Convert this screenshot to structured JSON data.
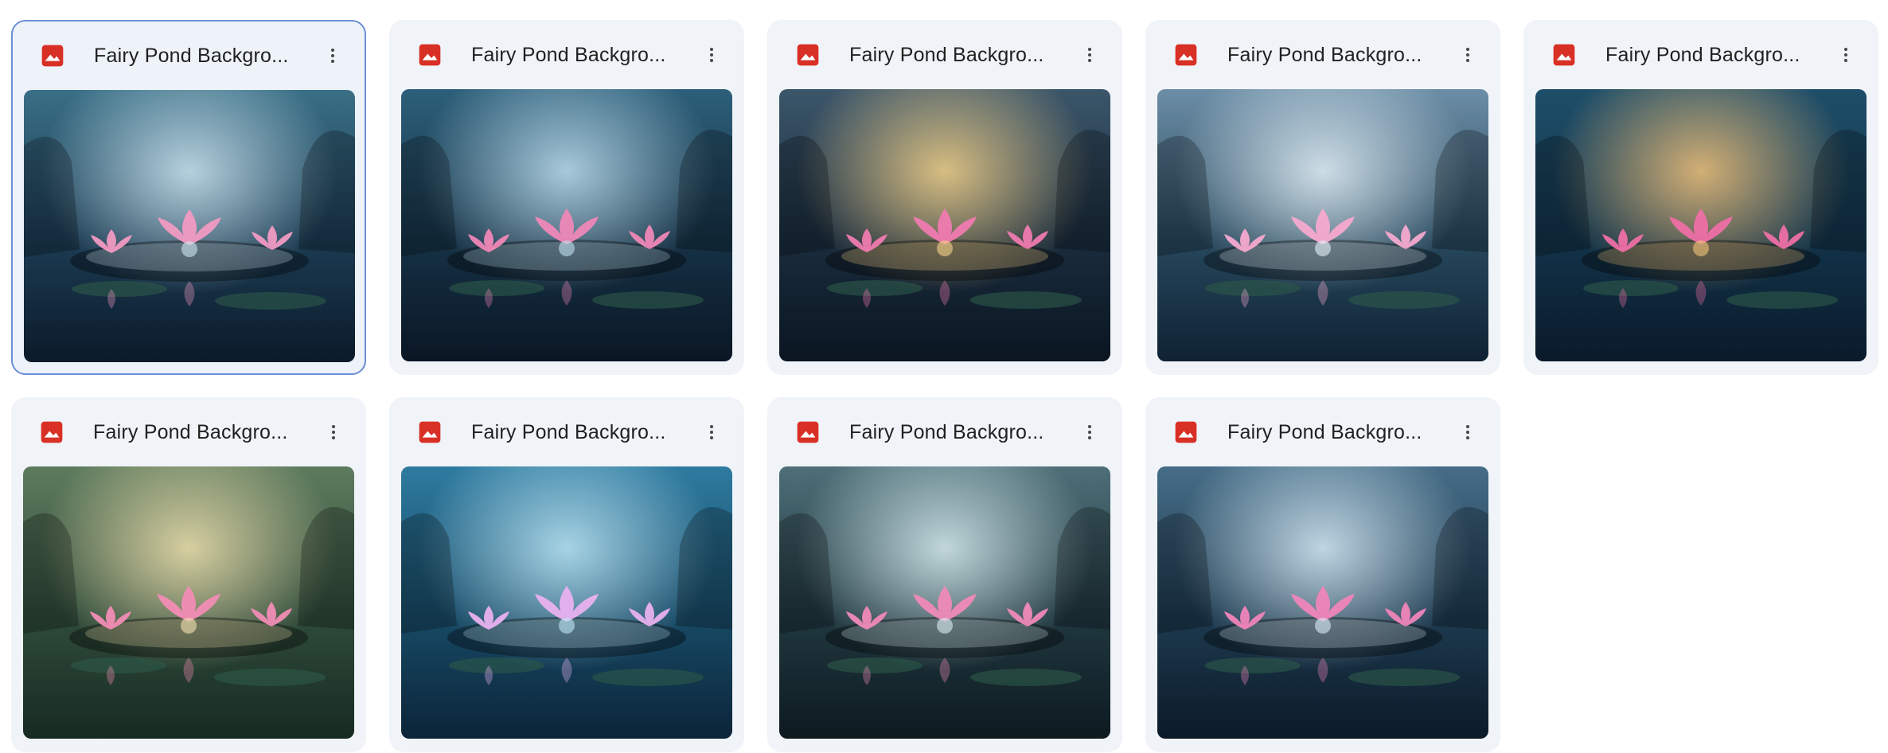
{
  "files": [
    {
      "title": "Fairy Pond Backgro...",
      "selected": true,
      "icon": "image-file-icon",
      "palette": {
        "top": "#3a6f86",
        "mid": "#1b3b52",
        "bottom": "#0c1a2a",
        "glow": "#cfe7f2",
        "lotus": "#f19ac2"
      }
    },
    {
      "title": "Fairy Pond Backgro...",
      "selected": false,
      "icon": "image-file-icon",
      "palette": {
        "top": "#2d5f7a",
        "mid": "#163246",
        "bottom": "#0a1624",
        "glow": "#bfe0f0",
        "lotus": "#ef88b8"
      }
    },
    {
      "title": "Fairy Pond Backgro...",
      "selected": false,
      "icon": "image-file-icon",
      "palette": {
        "top": "#3b566a",
        "mid": "#1a2c3d",
        "bottom": "#0a1521",
        "glow": "#f6d48a",
        "lotus": "#f07bb0"
      }
    },
    {
      "title": "Fairy Pond Backgro...",
      "selected": false,
      "icon": "image-file-icon",
      "palette": {
        "top": "#6c8ea6",
        "mid": "#27485d",
        "bottom": "#0f2233",
        "glow": "#e5f1f8",
        "lotus": "#f6a9cf"
      }
    },
    {
      "title": "Fairy Pond Backgro...",
      "selected": false,
      "icon": "image-file-icon",
      "palette": {
        "top": "#1e4e69",
        "mid": "#123349",
        "bottom": "#0a1a2a",
        "glow": "#f4c37a",
        "lotus": "#ee6fa6"
      }
    },
    {
      "title": "Fairy Pond Backgro...",
      "selected": false,
      "icon": "image-file-icon",
      "palette": {
        "top": "#5e7b5e",
        "mid": "#2f4b3a",
        "bottom": "#172a22",
        "glow": "#f1e2b0",
        "lotus": "#f28db5"
      }
    },
    {
      "title": "Fairy Pond Backgro...",
      "selected": false,
      "icon": "image-file-icon",
      "palette": {
        "top": "#2e7ba0",
        "mid": "#184a66",
        "bottom": "#0b2438",
        "glow": "#bfe8f7",
        "lotus": "#e9b2f0"
      }
    },
    {
      "title": "Fairy Pond Backgro...",
      "selected": false,
      "icon": "image-file-icon",
      "palette": {
        "top": "#4e6f78",
        "mid": "#20373f",
        "bottom": "#0d1a20",
        "glow": "#d9eef2",
        "lotus": "#f08ab8"
      }
    },
    {
      "title": "Fairy Pond Backgro...",
      "selected": false,
      "icon": "image-file-icon",
      "palette": {
        "top": "#466d87",
        "mid": "#1d3a4f",
        "bottom": "#0c1a28",
        "glow": "#d8ecf7",
        "lotus": "#f085ba"
      }
    }
  ],
  "icons": {
    "file_type": "image-file-icon",
    "more": "more-vertical-icon"
  },
  "colors": {
    "file_icon_red": "#d93025",
    "selected_border": "#6a8fd6",
    "card_bg": "#f0f4f9",
    "title_text": "#1f1f1f",
    "more_icon": "#444746"
  }
}
